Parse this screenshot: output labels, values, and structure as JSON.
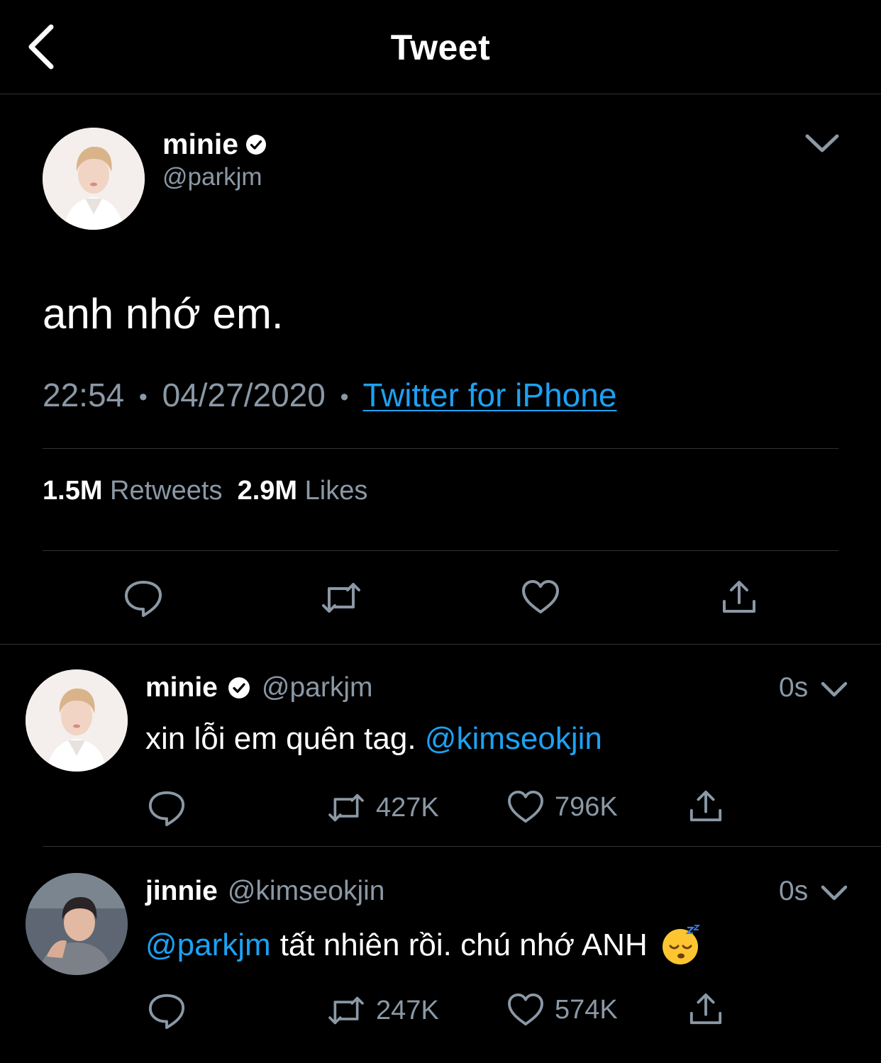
{
  "header": {
    "title": "Tweet",
    "back_icon": "chevron-left-icon"
  },
  "main_tweet": {
    "name": "minie",
    "handle": "@parkjm",
    "text": "anh nhớ em.",
    "time": "22:54",
    "date": "04/27/2020",
    "separator": "•",
    "source": "Twitter for iPhone",
    "retweets_count": "1.5M",
    "retweets_label": "Retweets",
    "likes_count": "2.9M",
    "likes_label": "Likes"
  },
  "replies": [
    {
      "name": "minie",
      "handle": "@parkjm",
      "time": "0s",
      "text": "xin lỗi em quên tag.",
      "mention": "@kimseokjin",
      "retweets": "427K",
      "likes": "796K"
    },
    {
      "name": "jinnie",
      "handle": "@kimseokjin",
      "time": "0s",
      "mention": "@parkjm",
      "text": "tất nhiên rồi. chú nhớ ANH",
      "retweets": "247K",
      "likes": "574K"
    }
  ],
  "colors": {
    "background": "#000000",
    "accent": "#1da1f2",
    "muted": "#8b98a5",
    "divider": "#2f3336"
  }
}
